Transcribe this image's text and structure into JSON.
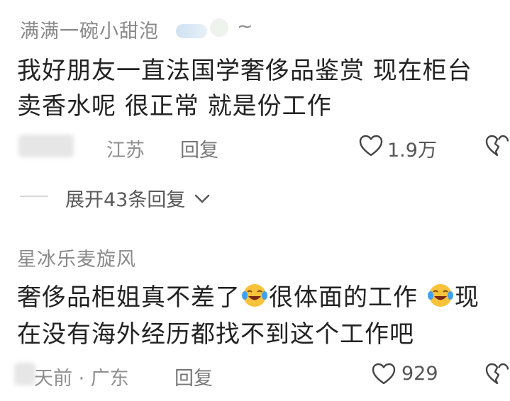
{
  "comment1": {
    "username": "满满一碗小甜泡",
    "username_suffix": "~",
    "text_line1": "我好朋友一直法国学奢侈品鉴赏  现在柜台",
    "text_line2": "卖香水呢  很正常  就是份工作",
    "location": "江苏",
    "reply_label": "回复",
    "like_count": "1.9万",
    "expand_label": "展开43条回复"
  },
  "comment2": {
    "username": "星冰乐麦旋风",
    "text_part1": "奢侈品柜姐真不差了",
    "text_part2": "很体面的工作",
    "text_part3": "现",
    "text_line2": "在没有海外经历都找不到这个工作吧",
    "time_location": "天前 · 广东",
    "reply_label": "回复",
    "like_count": "929"
  },
  "colors": {
    "username": "#8a8a8a",
    "content": "#222222",
    "meta": "#8f8f8f"
  }
}
